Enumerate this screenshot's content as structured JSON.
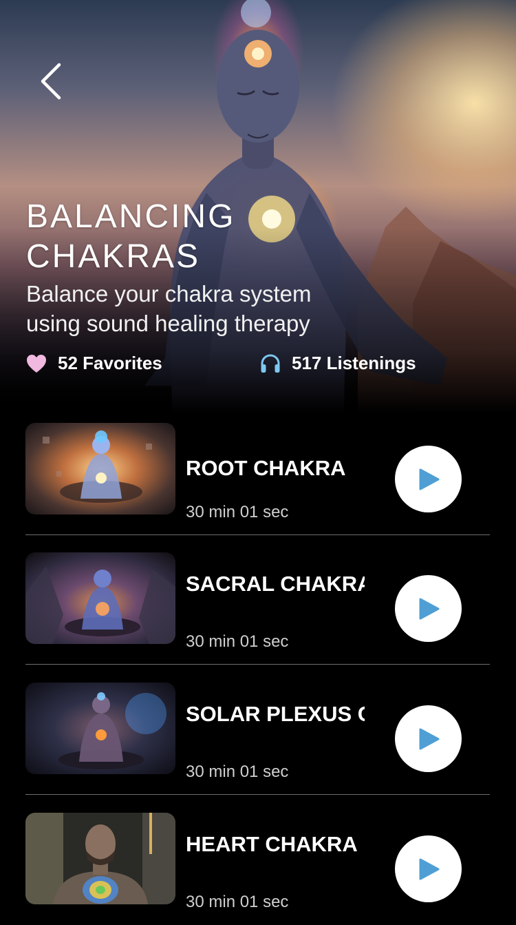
{
  "header": {
    "back_icon": "chevron-left-icon",
    "title": "BALANCING CHAKRAS",
    "subtitle": "Balance your chakra system using sound healing therapy",
    "favorites": {
      "icon": "heart-icon",
      "label": "52 Favorites",
      "color": "#f1b8e0"
    },
    "listenings": {
      "icon": "headphones-icon",
      "label": "517 Listenings",
      "color": "#7ec8f0"
    }
  },
  "tracks": [
    {
      "title": "ROOT CHAKRA",
      "duration": "30 min 01 sec",
      "thumb_icon": "meditating-figure-icon"
    },
    {
      "title": "SACRAL CHAKRA",
      "duration": "30 min 01 sec",
      "thumb_icon": "meditating-figure-icon"
    },
    {
      "title": "SOLAR PLEXUS CHAKRA",
      "duration": "30 min 01 sec",
      "thumb_icon": "meditating-figure-icon"
    },
    {
      "title": "HEART CHAKRA",
      "duration": "30 min 01 sec",
      "thumb_icon": "man-portrait-icon"
    }
  ],
  "play_icon": "play-icon",
  "colors": {
    "background": "#000000",
    "play_accent": "#4f9fd5",
    "divider": "#6e6e6e"
  }
}
